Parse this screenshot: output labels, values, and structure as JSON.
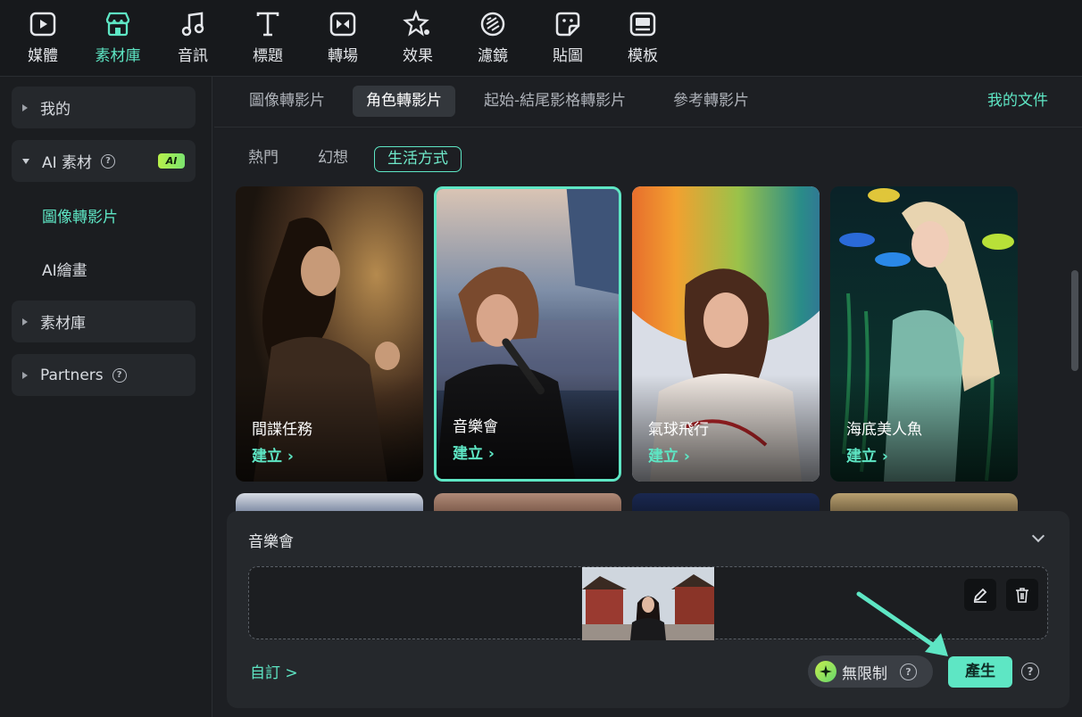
{
  "toolbar": {
    "items": [
      {
        "label": "媒體",
        "icon": "media-icon"
      },
      {
        "label": "素材庫",
        "icon": "store-icon"
      },
      {
        "label": "音訊",
        "icon": "music-note-icon"
      },
      {
        "label": "標題",
        "icon": "text-t-icon"
      },
      {
        "label": "轉場",
        "icon": "transition-icon"
      },
      {
        "label": "效果",
        "icon": "effects-star-icon"
      },
      {
        "label": "濾鏡",
        "icon": "filter-icon"
      },
      {
        "label": "貼圖",
        "icon": "sticker-icon"
      },
      {
        "label": "模板",
        "icon": "template-icon"
      }
    ],
    "active": "素材庫"
  },
  "sidebar": {
    "my": "我的",
    "ai_assets": "AI 素材",
    "ai_badge": "AI",
    "sub_img2video": "圖像轉影片",
    "sub_ai_paint": "AI繪畫",
    "library": "素材庫",
    "partners": "Partners"
  },
  "tabs": [
    "圖像轉影片",
    "角色轉影片",
    "起始-結尾影格轉影片",
    "參考轉影片"
  ],
  "active_tab": "角色轉影片",
  "my_docs": "我的文件",
  "filters": [
    "熱門",
    "幻想",
    "生活方式"
  ],
  "active_filter": "生活方式",
  "cards": [
    {
      "name": "間諜任務",
      "action": "建立 ›"
    },
    {
      "name": "音樂會",
      "action": "建立 ›"
    },
    {
      "name": "氣球飛行",
      "action": "建立 ›"
    },
    {
      "name": "海底美人魚",
      "action": "建立 ›"
    }
  ],
  "panel": {
    "title": "音樂會",
    "custom": "自訂 >",
    "unlimited": "無限制",
    "generate": "產生"
  },
  "colors": {
    "accent": "#5ee6c4",
    "background": "#1d1f23",
    "panel": "#25282c"
  }
}
